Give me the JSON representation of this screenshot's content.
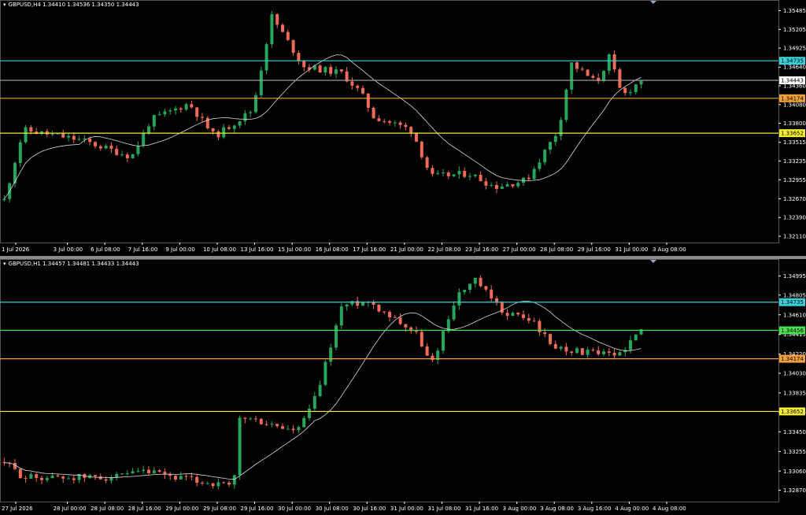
{
  "colors": {
    "bull": "#26a65b",
    "bear": "#f06a5a",
    "ma": "#d8d8d8",
    "cyan": "#3ad0d8",
    "orange": "#f2a03a",
    "yellow": "#f5ee33",
    "green_level": "#4be04b",
    "axis": "#ffffff"
  },
  "panels": [
    {
      "id": "h4",
      "header": "GBPUSD,H4  1.34410 1.34536 1.34350 1.34443",
      "price_labels": [
        "1.35485",
        "1.35205",
        "1.34925",
        "1.34640",
        "1.34360",
        "1.34080",
        "1.33800",
        "1.33515",
        "1.33235",
        "1.32955",
        "1.32670",
        "1.32390",
        "1.32110"
      ],
      "time_labels": [
        "1 Jul 2026",
        "3 Jul 00:00",
        "6 Jul 08:00",
        "7 Jul 16:00",
        "9 Jul 00:00",
        "10 Jul 08:00",
        "13 Jul 16:00",
        "15 Jul 00:00",
        "16 Jul 08:00",
        "17 Jul 16:00",
        "21 Jul 00:00",
        "22 Jul 08:00",
        "23 Jul 16:00",
        "27 Jul 00:00",
        "28 Jul 08:00",
        "29 Jul 16:00",
        "31 Jul 00:00",
        "3 Aug 08:00"
      ],
      "levels": [
        {
          "name": "cyan",
          "value": "1.34735"
        },
        {
          "name": "current",
          "value": "1.34443"
        },
        {
          "name": "orange",
          "value": "1.34174"
        },
        {
          "name": "yellow",
          "value": "1.33652"
        }
      ],
      "ylim": [
        1.3211,
        1.3555
      ]
    },
    {
      "id": "h1",
      "header": "GBPUSD,H1  1.34457 1.34481 1.34433 1.34443",
      "price_labels": [
        "1.34995",
        "1.34805",
        "1.34610",
        "1.34415",
        "1.34220",
        "1.34030",
        "1.33835",
        "1.33645",
        "1.33450",
        "1.33255",
        "1.33060",
        "1.32870"
      ],
      "time_labels": [
        "27 Jul 2026",
        "28 Jul 00:00",
        "28 Jul 08:00",
        "28 Jul 16:00",
        "29 Jul 00:00",
        "29 Jul 08:00",
        "29 Jul 16:00",
        "30 Jul 00:00",
        "30 Jul 08:00",
        "30 Jul 16:00",
        "31 Jul 00:00",
        "31 Jul 08:00",
        "31 Jul 16:00",
        "3 Aug 00:00",
        "3 Aug 08:00",
        "3 Aug 16:00",
        "4 Aug 00:00",
        "4 Aug 08:00"
      ],
      "levels": [
        {
          "name": "cyan",
          "value": "1.34735"
        },
        {
          "name": "green",
          "value": "1.34456"
        },
        {
          "name": "orange",
          "value": "1.34174"
        },
        {
          "name": "yellow",
          "value": "1.33652"
        }
      ],
      "ylim": [
        1.3282,
        1.351
      ]
    }
  ]
}
